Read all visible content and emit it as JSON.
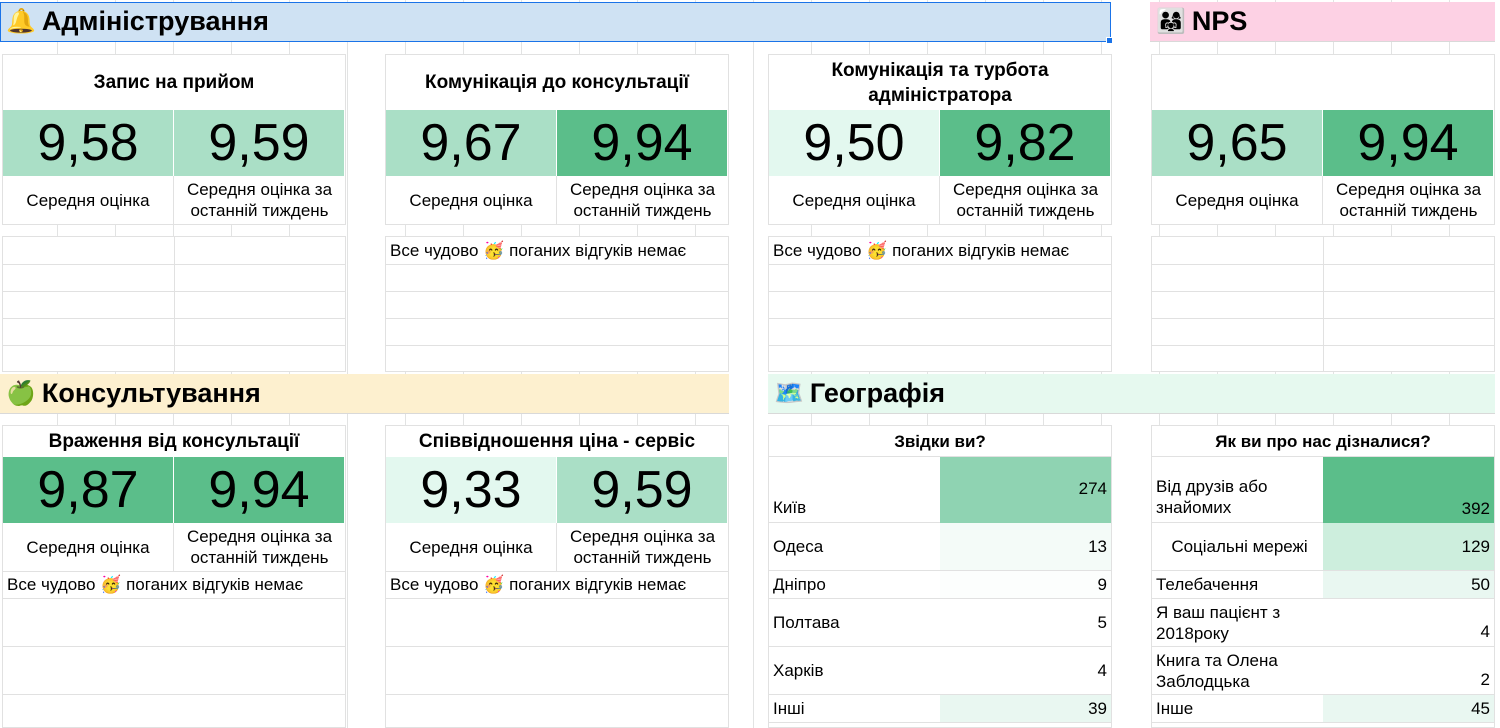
{
  "admin": {
    "header": "Адміністрування",
    "icon": "bell-icon",
    "cards": [
      {
        "title": "Запис на прийом",
        "avg": "9,58",
        "week": "9,59",
        "cap_avg": "Середня оцінка",
        "cap_week": "Середня оцінка за останній тиждень",
        "note": ""
      },
      {
        "title": "Комунікація до консультації",
        "avg": "9,67",
        "week": "9,94",
        "cap_avg": "Середня оцінка",
        "cap_week": "Середня оцінка за останній тиждень",
        "note": "Все чудово 🥳 поганих відгуків немає"
      },
      {
        "title": "Комунікація та турбота адміністратора",
        "avg": "9,50",
        "week": "9,82",
        "cap_avg": "Середня оцінка",
        "cap_week": "Середня оцінка за останній тиждень",
        "note": "Все чудово 🥳 поганих відгуків немає"
      }
    ]
  },
  "nps": {
    "header": "NPS",
    "icon": "family-icon",
    "avg": "9,65",
    "week": "9,94",
    "cap_avg": "Середня оцінка",
    "cap_week": "Середня оцінка за останній тиждень"
  },
  "consult": {
    "header": "Консультування",
    "icon": "apple-icon",
    "cards": [
      {
        "title": "Враження від консультації",
        "avg": "9,87",
        "week": "9,94",
        "cap_avg": "Середня оцінка",
        "cap_week": "Середня оцінка за останній тиждень",
        "note": "Все чудово 🥳 поганих відгуків немає"
      },
      {
        "title": "Співвідношення ціна - сервіс",
        "avg": "9,33",
        "week": "9,59",
        "cap_avg": "Середня оцінка",
        "cap_week": "Середня оцінка за останній тиждень",
        "note": "Все чудово 🥳 поганих відгуків немає"
      }
    ]
  },
  "geo": {
    "header": "Географія",
    "icon": "map-icon",
    "title": "Звідки ви?",
    "rows": [
      {
        "label": "Київ",
        "value": "274"
      },
      {
        "label": "Одеса",
        "value": "13"
      },
      {
        "label": "Дніпро",
        "value": "9"
      },
      {
        "label": "Полтава",
        "value": "5"
      },
      {
        "label": "Харків",
        "value": "4"
      },
      {
        "label": "Інші",
        "value": "39"
      }
    ]
  },
  "source": {
    "title": "Як ви про нас дізналися?",
    "rows": [
      {
        "label": "Від друзів або знайомих",
        "value": "392"
      },
      {
        "label": "Соціальні мережі",
        "value": "129"
      },
      {
        "label": "Телебачення",
        "value": "50"
      },
      {
        "label": "Я ваш пацієнт з 2018року",
        "value": "4"
      },
      {
        "label": "Книга та Олена Заблодцька",
        "value": "2"
      },
      {
        "label": "Інше",
        "value": "45"
      }
    ]
  },
  "colors": {
    "admin_header": "#cfe2f3",
    "nps_header": "#fdd1e4",
    "consult_header": "#fdf0cf",
    "geo_header": "#e6f9ef",
    "score_light": "#e3f8ef",
    "score_mid": "#aadfc6",
    "score_dark": "#5bbe8a"
  }
}
